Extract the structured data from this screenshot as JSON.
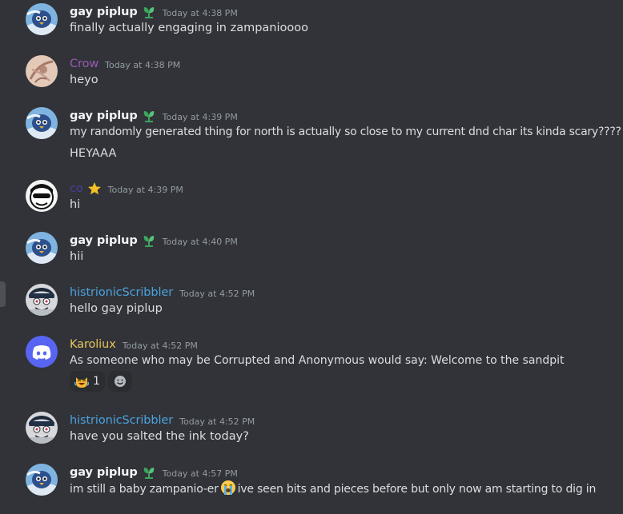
{
  "colors": {
    "background": "#313338",
    "text": "#dbdee1",
    "timestamp": "#949ba4",
    "piplup_name": "#f2f3f5",
    "crow_name": "#9b59b6",
    "co_name": "#4a3c9e",
    "scribbler_name": "#4aa3df",
    "karoliux_name": "#e8c55a",
    "discord_blurple": "#5865f2"
  },
  "messages": [
    {
      "author": "gay piplup",
      "badge": "sprout-badge-icon",
      "timestamp": "Today at 4:38 PM",
      "lines": [
        "finally actually engaging in zampanioooo"
      ]
    },
    {
      "author": "Crow",
      "timestamp": "Today at 4:38 PM",
      "lines": [
        "heyo"
      ]
    },
    {
      "author": "gay piplup",
      "badge": "sprout-badge-icon",
      "timestamp": "Today at 4:39 PM",
      "lines": [
        "my randomly generated thing for north is actually so close to my current dnd char its kinda scary????",
        "HEYAAA"
      ]
    },
    {
      "author": "co",
      "badge": "star-badge-icon",
      "timestamp": "Today at 4:39 PM",
      "lines": [
        "hi"
      ]
    },
    {
      "author": "gay piplup",
      "badge": "sprout-badge-icon",
      "timestamp": "Today at 4:40 PM",
      "lines": [
        "hii"
      ]
    },
    {
      "author": "histrionicScribbler",
      "timestamp": "Today at 4:52 PM",
      "lines": [
        "hello gay piplup"
      ]
    },
    {
      "author": "Karoliux",
      "timestamp": "Today at 4:52 PM",
      "lines": [
        "As someone who may be Corrupted and Anonymous would say: Welcome to the sandpit"
      ],
      "reactions": [
        {
          "emoji": "laughing-cat-emoji",
          "count": "1"
        }
      ]
    },
    {
      "author": "histrionicScribbler",
      "timestamp": "Today at 4:52 PM",
      "lines": [
        "have you salted the ink today?"
      ]
    },
    {
      "author": "gay piplup",
      "badge": "sprout-badge-icon",
      "timestamp": "Today at 4:57 PM",
      "line_before_emoji": "im still a baby zampanio-er",
      "inline_emoji": "loudly-crying-emoji",
      "line_after_emoji": "ive seen bits and pieces before but only now am starting to dig in"
    }
  ]
}
